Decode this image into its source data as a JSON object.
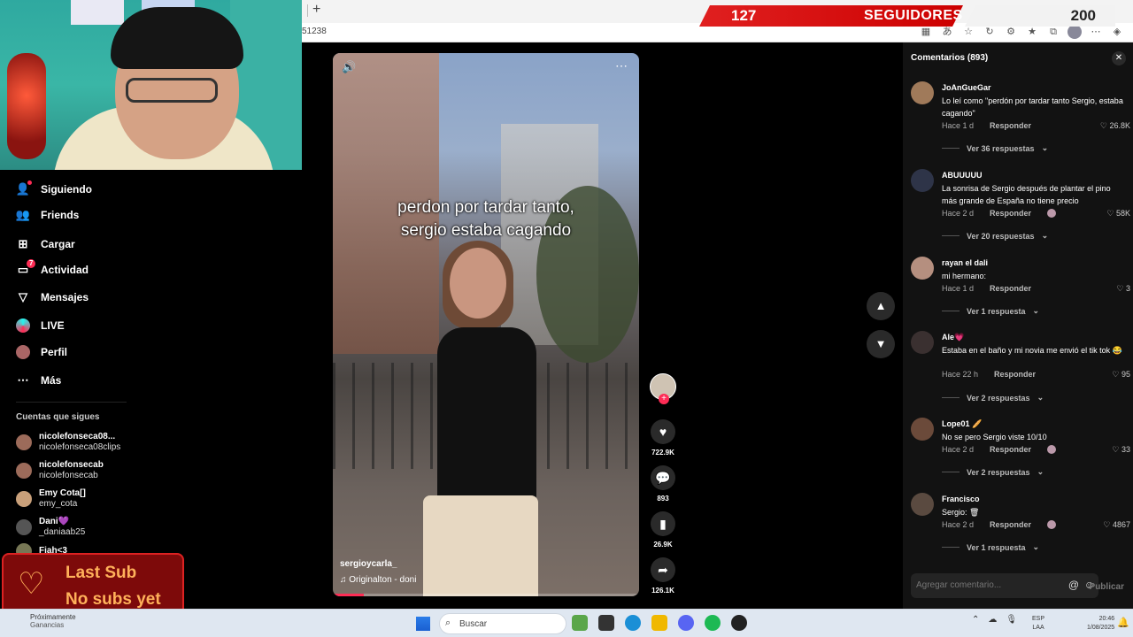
{
  "browser": {
    "new_tab": "+",
    "url_fragment": "51238"
  },
  "overlay_followers": {
    "current": "127",
    "label": "SEGUIDORES",
    "goal": "200",
    "progress_fraction": 0.635
  },
  "sidebar": {
    "items": [
      {
        "label": "Siguiendo",
        "icon": "following-icon"
      },
      {
        "label": "Friends",
        "icon": "friends-icon"
      },
      {
        "label": "Cargar",
        "icon": "upload-icon"
      },
      {
        "label": "Actividad",
        "icon": "activity-icon",
        "badge": "7"
      },
      {
        "label": "Mensajes",
        "icon": "messages-icon"
      },
      {
        "label": "LIVE",
        "icon": "live-icon"
      },
      {
        "label": "Perfil",
        "icon": "profile-icon"
      },
      {
        "label": "Más",
        "icon": "more-icon"
      }
    ],
    "following_title": "Cuentas que sigues",
    "accounts": [
      {
        "name": "nicolefonseca08...",
        "handle": "nicolefonseca08clips"
      },
      {
        "name": "nicolefonsecab",
        "handle": "nicolefonsecab"
      },
      {
        "name": "Emy Cota[]",
        "handle": "emy_cota"
      },
      {
        "name": "Dani💜",
        "handle": "_daniaab25"
      },
      {
        "name": "Fiah<3",
        "handle": ""
      }
    ]
  },
  "last_sub": {
    "title": "Last Sub",
    "value": "No subs yet"
  },
  "video": {
    "caption_line1": "perdon por tardar tanto,",
    "caption_line2": "sergio estaba cagando",
    "author": "sergioycarla_",
    "music": "Originalton - doni",
    "progress_fraction": 0.1
  },
  "actions": {
    "likes": "722.9K",
    "comments": "893",
    "saves": "26.9K",
    "shares": "126.1K"
  },
  "comments_panel": {
    "title": "Comentarios (893)",
    "input_placeholder": "Agregar comentario...",
    "publish": "Publicar",
    "items": [
      {
        "user": "JoAnGueGar",
        "text": "Lo leí como \"perdón por tardar tanto Sergio, estaba cagando\"",
        "time": "Hace 1 d",
        "reply": "Responder",
        "likes": "26.8K",
        "replies": "Ver 36 respuestas",
        "creator_liked": false
      },
      {
        "user": "ABUUUUU",
        "text": "La sonrisa de Sergio después de plantar el pino más grande de España no tiene precio",
        "time": "Hace 2 d",
        "reply": "Responder",
        "likes": "58K",
        "replies": "Ver 20 respuestas",
        "creator_liked": true
      },
      {
        "user": "rayan el dali",
        "text": "mi hermano:",
        "time": "Hace 1 d",
        "reply": "Responder",
        "likes": "3",
        "replies": "Ver 1 respuesta",
        "creator_liked": false
      },
      {
        "user": "Ale💗",
        "text": "Estaba en el baño y mi novia me envió el tik tok 😂",
        "time": "Hace 22 h",
        "reply": "Responder",
        "likes": "95",
        "replies": "Ver 2 respuestas",
        "creator_liked": false
      },
      {
        "user": "Lope01 🥖",
        "text": "No se pero Sergio viste 10/10",
        "time": "Hace 2 d",
        "reply": "Responder",
        "likes": "33",
        "replies": "Ver 2 respuestas",
        "creator_liked": true
      },
      {
        "user": "Francisco",
        "text": "Sergio: 🗑",
        "time": "Hace 2 d",
        "reply": "Responder",
        "likes": "4867",
        "replies": "Ver 1 respuesta",
        "creator_liked": true
      }
    ]
  },
  "taskbar": {
    "news_line1": "Próximamente",
    "news_line2": "Ganancias",
    "search": "Buscar",
    "lang1": "ESP",
    "lang2": "LAA",
    "time": "20:46",
    "date": "1/08/2025"
  }
}
